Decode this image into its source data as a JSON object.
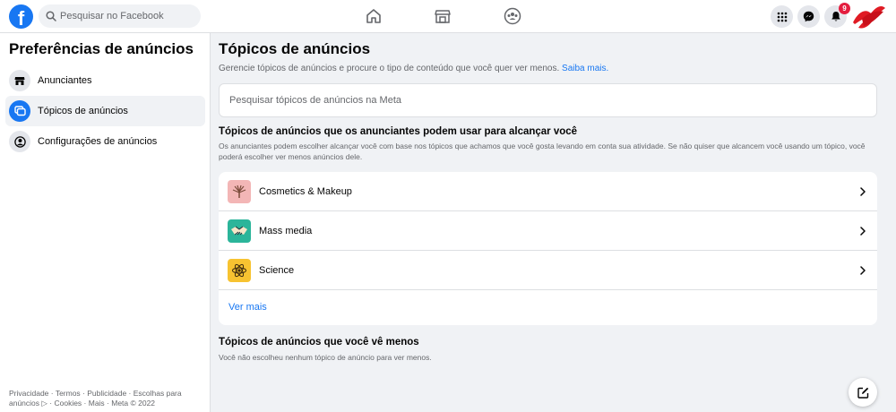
{
  "header": {
    "logo_glyph": "f",
    "search_placeholder": "Pesquisar no Facebook",
    "nav_icons": [
      "home-icon",
      "marketplace-icon",
      "groups-icon"
    ],
    "right_icons": [
      "menu-grid-icon",
      "messenger-icon",
      "bell-icon"
    ],
    "notification_count": "9"
  },
  "sidebar": {
    "title": "Preferências de anúncios",
    "items": [
      {
        "label": "Anunciantes",
        "icon": "store-icon",
        "active": false
      },
      {
        "label": "Tópicos de anúncios",
        "icon": "topics-icon",
        "active": true
      },
      {
        "label": "Configurações de anúncios",
        "icon": "user-settings-icon",
        "active": false
      }
    ],
    "footer": "Privacidade · Termos · Publicidade · Escolhas para anúncios ▷ · Cookies · Mais · Meta © 2022"
  },
  "main": {
    "title": "Tópicos de anúncios",
    "description": "Gerencie tópicos de anúncios e procure o tipo de conteúdo que você quer ver menos.",
    "learn_more": "Saiba mais.",
    "search_placeholder": "Pesquisar tópicos de anúncios na Meta",
    "section1_title": "Tópicos de anúncios que os anunciantes podem usar para alcançar você",
    "section1_desc": "Os anunciantes podem escolher alcançar você com base nos tópicos que achamos que você gosta levando em conta sua atividade. Se não quiser que alcancem você usando um tópico, você poderá escolher ver menos anúncios dele.",
    "topics": [
      {
        "label": "Cosmetics & Makeup",
        "icon": "makeup-brush-icon",
        "color": "#f3b6b6"
      },
      {
        "label": "Mass media",
        "icon": "handshake-icon",
        "color": "#2bb59a"
      },
      {
        "label": "Science",
        "icon": "atom-icon",
        "color": "#f7c331"
      }
    ],
    "see_more": "Ver mais",
    "section2_title": "Tópicos de anúncios que você vê menos",
    "section2_desc": "Você não escolheu nenhum tópico de anúncio para ver menos."
  },
  "colors": {
    "brand": "#1877f2",
    "badge": "#e41e3f",
    "background": "#f0f2f5"
  }
}
